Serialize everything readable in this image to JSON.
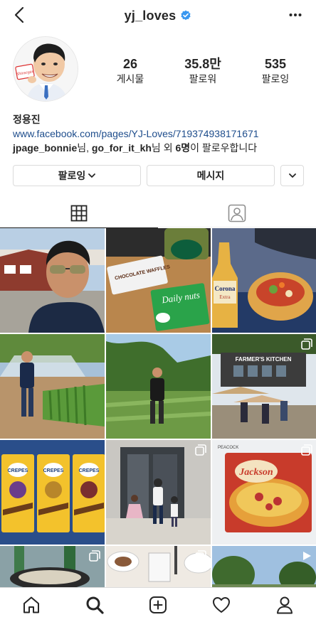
{
  "header": {
    "username": "yj_loves"
  },
  "stats": [
    {
      "value": "26",
      "label": "게시물"
    },
    {
      "value": "35.8만",
      "label": "팔로워"
    },
    {
      "value": "535",
      "label": "팔로잉"
    }
  ],
  "bio": {
    "name": "정용진",
    "link": "www.facebook.com/pages/YJ-Loves/719374938171671",
    "followed_by_1": "jpage_bonnie",
    "followed_by_sep1": "님, ",
    "followed_by_2": "go_for_it_kh",
    "followed_by_sep2": "님 외 ",
    "followed_by_count": "6명",
    "followed_by_suffix": "이 팔로우합니다"
  },
  "actions": {
    "following_label": "팔로잉",
    "message_label": "메시지"
  },
  "avatar_sign_text": "Shinsegae",
  "products": {
    "waffles": "CHOCOLATE WAFFLES",
    "daily_nuts": "Daily nuts",
    "corona": "Corona",
    "corona_sub": "Extra",
    "farmers_kitchen": "FARMER'S KITCHEN",
    "crepes": "CREPES",
    "jackson": "Jackson",
    "peacock": "PEACOCK"
  },
  "colors": {
    "verified": "#3897f0",
    "link": "#1e4d8c",
    "border": "#dbdbdb"
  }
}
